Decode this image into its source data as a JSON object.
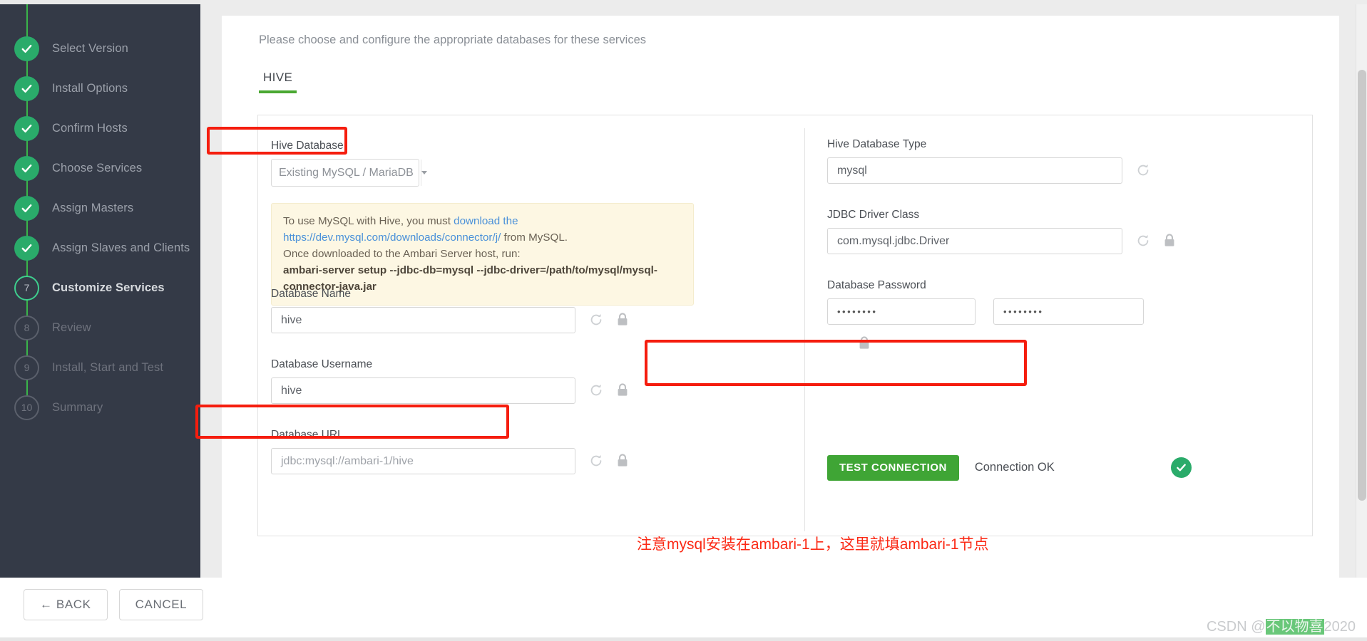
{
  "sidebar": {
    "steps": [
      {
        "label": "Select Version",
        "marker": "check",
        "state": "done"
      },
      {
        "label": "Install Options",
        "marker": "check",
        "state": "done"
      },
      {
        "label": "Confirm Hosts",
        "marker": "check",
        "state": "done"
      },
      {
        "label": "Choose Services",
        "marker": "check",
        "state": "done"
      },
      {
        "label": "Assign Masters",
        "marker": "check",
        "state": "done"
      },
      {
        "label": "Assign Slaves and Clients",
        "marker": "check",
        "state": "done"
      },
      {
        "label": "Customize Services",
        "marker": "7",
        "state": "current"
      },
      {
        "label": "Review",
        "marker": "8",
        "state": "pending"
      },
      {
        "label": "Install, Start and Test",
        "marker": "9",
        "state": "pending"
      },
      {
        "label": "Summary",
        "marker": "10",
        "state": "pending"
      }
    ]
  },
  "main": {
    "instruction": "Please choose and configure the appropriate databases for these services",
    "tabs": [
      {
        "label": "HIVE",
        "active": true
      }
    ]
  },
  "left": {
    "hive_database": {
      "label": "Hive Database",
      "value": "Existing MySQL / MariaDB",
      "caret_icon": "chevron-down-icon"
    },
    "alert": {
      "line1_pre": "To use MySQL with Hive, you must ",
      "line1_link": "download the https://dev.mysql.com/downloads/connector/j/",
      "line1_post": " from MySQL.",
      "line2": "Once downloaded to the Ambari Server host, run:",
      "command": "ambari-server setup --jdbc-db=mysql --jdbc-driver=/path/to/mysql/mysql-connector-java.jar"
    },
    "database_name": {
      "label": "Database Name",
      "value": "hive"
    },
    "database_username": {
      "label": "Database Username",
      "value": "hive"
    },
    "database_url": {
      "label": "Database URL",
      "value": "jdbc:mysql://ambari-1/hive"
    }
  },
  "right": {
    "hive_database_type": {
      "label": "Hive Database Type",
      "value": "mysql"
    },
    "jdbc_driver_class": {
      "label": "JDBC Driver Class",
      "value": "com.mysql.jdbc.Driver"
    },
    "database_password": {
      "label": "Database Password",
      "value": "••••••••",
      "confirm_value": "••••••••"
    },
    "test_connection": {
      "button_label": "TEST CONNECTION",
      "status": "Connection OK",
      "status_icon": "check-circle-icon"
    }
  },
  "annotation": {
    "note": "注意mysql安装在ambari-1上，这里就填ambari-1节点",
    "color": "#fb2915"
  },
  "footer": {
    "back_label": "← BACK",
    "cancel_label": "CANCEL",
    "watermark_prefix": "CSDN @",
    "watermark_highlight": "不以物喜",
    "watermark_suffix": "2020"
  },
  "icons": {
    "refresh": "refresh-icon",
    "lock": "lock-icon"
  },
  "colors": {
    "accent_green": "#3ab54a",
    "sidebar_bg": "#343a47",
    "annotation_red": "#f51d0e",
    "button_green": "#3fa535",
    "link_blue": "#4a90d9"
  }
}
